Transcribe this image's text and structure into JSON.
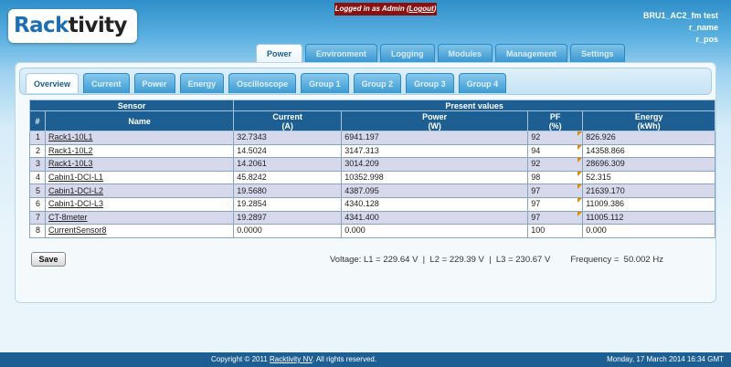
{
  "logo": {
    "part1": "Rack",
    "part2": "tivity"
  },
  "login": {
    "prefix": "Logged in as Admin (",
    "logout": "Logout",
    "suffix": ")"
  },
  "user": {
    "line1": "BRU1_AC2_fm test",
    "line2": "r_name",
    "line3": "r_pos"
  },
  "main_tabs": [
    "Power",
    "Environment",
    "Logging",
    "Modules",
    "Management",
    "Settings"
  ],
  "sub_tabs": [
    "Overview",
    "Current",
    "Power",
    "Energy",
    "Oscilloscope",
    "Group 1",
    "Group 2",
    "Group 3",
    "Group 4"
  ],
  "table": {
    "group_sensor": "Sensor",
    "group_present": "Present values",
    "col_index": "#",
    "col_name": "Name",
    "col_current": "Current",
    "col_current_unit": "(A)",
    "col_power": "Power",
    "col_power_unit": "(W)",
    "col_pf": "PF",
    "col_pf_unit": "(%)",
    "col_energy": "Energy",
    "col_energy_unit": "(kWh)",
    "rows": [
      {
        "idx": "1",
        "name": "Rack1-10L1",
        "current": "32.7343",
        "power": "6941.197",
        "pf": "92",
        "energy": "826.926"
      },
      {
        "idx": "2",
        "name": "Rack1-10L2",
        "current": "14.5024",
        "power": "3147.313",
        "pf": "94",
        "energy": "14358.866"
      },
      {
        "idx": "3",
        "name": "Rack1-10L3",
        "current": "14.2061",
        "power": "3014.209",
        "pf": "92",
        "energy": "28696.309"
      },
      {
        "idx": "4",
        "name": "Cabin1-DCI-L1",
        "current": "45.8242",
        "power": "10352.998",
        "pf": "98",
        "energy": "52.315"
      },
      {
        "idx": "5",
        "name": "Cabin1-DCI-L2",
        "current": "19.5680",
        "power": "4387.095",
        "pf": "97",
        "energy": "21639.170"
      },
      {
        "idx": "6",
        "name": "Cabin1-DCI-L3",
        "current": "19.2854",
        "power": "4340.128",
        "pf": "97",
        "energy": "11009.386"
      },
      {
        "idx": "7",
        "name": "CT-8meter",
        "current": "19.2897",
        "power": "4341.400",
        "pf": "97",
        "energy": "11005.112"
      },
      {
        "idx": "8",
        "name": "CurrentSensor8",
        "current": "0.0000",
        "power": "0.000",
        "pf": "100",
        "energy": "0.000"
      }
    ]
  },
  "save_label": "Save",
  "status": {
    "voltage": "Voltage: L1 = 229.64 V  |  L2 = 229.39 V  |  L3 = 230.67 V",
    "frequency": "Frequency =  50.002 Hz"
  },
  "footer": {
    "copy_prefix": "Copyright © 2011 ",
    "copy_link": "Racktivity NV",
    "copy_suffix": ". All rights reserved.",
    "date": "Monday, 17 March 2014 16:34 GMT"
  }
}
